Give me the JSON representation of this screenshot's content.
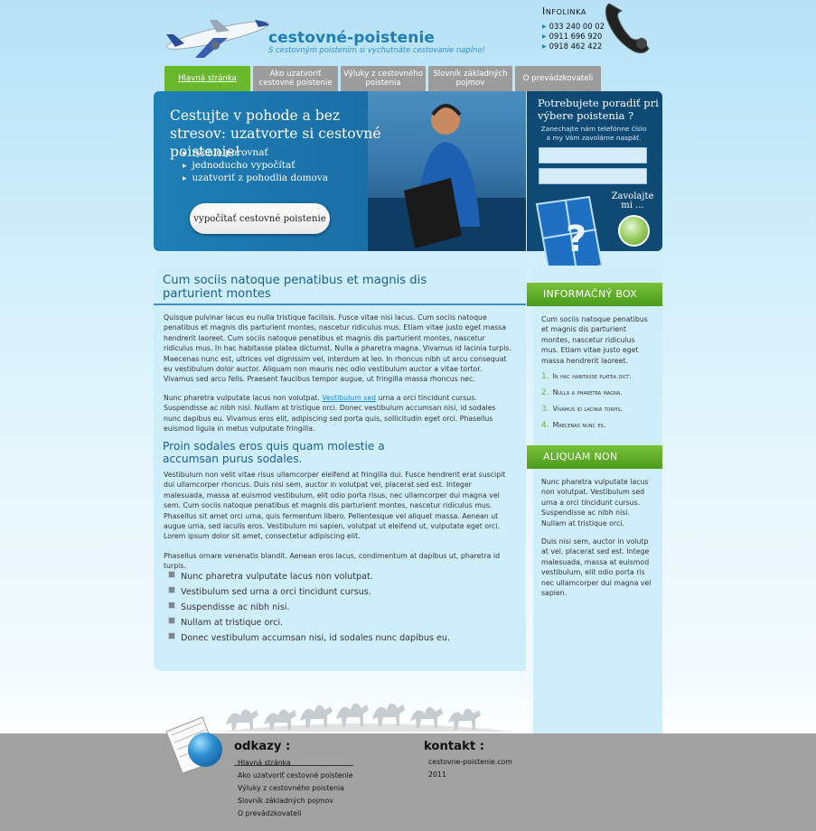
{
  "header": {
    "site_title": "cestovné-poistenie",
    "slogan": "S cestovným poistením si vychutnáte cestovanie naplno!",
    "infolinka_title": "Infolinka",
    "phones": [
      "033 240 00 02",
      "0911 696 920",
      "0918 462 422"
    ]
  },
  "nav": {
    "items": [
      {
        "label": "Hlavná stránka",
        "active": true
      },
      {
        "label": "Ako uzatvoriť cestovné poistenie"
      },
      {
        "label": "Výluky z cestovného poistenia"
      },
      {
        "label": "Slovník základných pojmov"
      },
      {
        "label": "O prevádzkovateli"
      }
    ]
  },
  "banner": {
    "headline": "Cestujte v pohode a bez stresov: uzatvorte si cestovné poistenie!",
    "bullets": [
      "rýchlo porovnať",
      "jednoducho vypočítať",
      "uzatvoriť z pohodlia domova"
    ],
    "cta_label": "vypočítať cestovné poistenie"
  },
  "callbox": {
    "title": "Potrebujete poradiť pri výbere poistenia ?",
    "subtitle": "Zanechajte nám telefónne číslo a my Vám zavoláme naspäť.",
    "call_label": "Zavolajte mi ..."
  },
  "main": {
    "heading1": "Cum sociis natoque penatibus et magnis dis parturient montes",
    "para1": "Quisque pulvinar lacus eu nulla tristique facilisis. Fusce vitae nisi lacus. Cum sociis natoque penatibus et magnis dis parturient montes, nascetur ridiculus mus. Etiam vitae justo eget massa hendrerit laoreet. Cum sociis natoque penatibus et magnis dis parturient montes, nascetur ridiculus mus. In hac habitasse platea dictumst. Nulla a pharetra magna. Vivamus id lacinia turpis. Maecenas nunc est, ultrices vel dignissim vel, interdum at leo. In rhoncus nibh ut arcu consequat eu vestibulum dolor auctor. Aliquam non mauris nec odio vestibulum auctor a vitae tortor. Vivamus sed arcu felis. Praesent faucibus tempor augue, ut fringilla massa rhoncus nec.",
    "para2_before": "Nunc pharetra vulputate lacus non volutpat. ",
    "para2_link": "Vestibulum sed",
    "para2_after": " urna a orci tincidunt cursus. Suspendisse ac nibh nisi. Nullam at tristique orci. Donec vestibulum accumsan nisi, id sodales nunc dapibus eu. Vivamus eros elit, adipiscing sed porta quis, sollicitudin eget orci. Phasellus euismod ligula in metus vulputate fringilla.",
    "heading2": "Proin sodales eros quis quam molestie a accumsan purus sodales.",
    "para3": "Vestibulum non velit vitae risus ullamcorper eleifend at fringilla dui. Fusce hendrerit erat suscipit dui ullamcorper rhoncus. Duis nisi sem, auctor in volutpat vel, placerat sed est. Integer malesuada, massa at euismod vestibulum, elit odio porta risus, nec ullamcorper dui magna vel sem. Cum sociis natoque penatibus et magnis dis parturient montes, nascetur ridiculus mus. Phasellus sit amet orci urna, quis fermentum libero. Pellentesque vel aliquet massa. Aenean ut augue urna, sed iaculis eros. Vestibulum mi sapien, volutpat ut eleifend ut, vulputate eget orci. Lorem ipsum dolor sit amet, consectetur adipiscing elit.",
    "para4": "Phasellus ornare venenatis blandit. Aenean eros lacus, condimentum at dapibus ut, pharetra id turpis.",
    "bullets": [
      "Nunc pharetra vulputate lacus non volutpat.",
      "Vestibulum sed urna a orci tincidunt cursus.",
      "Suspendisse ac nibh nisi.",
      "Nullam at tristique orci.",
      "Donec vestibulum accumsan nisi, id sodales nunc dapibus eu."
    ]
  },
  "sidebar": {
    "box1_title": "INFORMAČNÝ BOX",
    "box1_text": "Cum sociis natoque penatibus et magnis dis parturient montes, nascetur ridiculus mus. Etiam vitae justo eget massa hendrerit laoreet.",
    "box1_items": [
      "In hac habitasse platea dict.",
      "Nulla a pharetra magna.",
      "Vivamus id lacinia turpis.",
      "Maecenas nunc es."
    ],
    "box2_title": "ALIQUAM NON",
    "box2_text1": "Nunc pharetra vulputate lacus non volutpat. Vestibulum sed urna a orci tincidunt cursus. Suspendisse ac nibh nisi. Nullam at tristique orci.",
    "box2_text2": "Duis nisi sem, auctor in volutp at vel, placerat sed est. Intege malesuada, massa at euismod vestibulum, elit odio porta ris nec ullamcorper dui magna vel sapien."
  },
  "footer": {
    "links_title": "odkazy :",
    "links": [
      "Hlavná stránka",
      "Ako uzatvoriť cestovné poistenie",
      "Výluky z cestovného poistenia",
      "Slovník základných pojmov",
      "O prevádzkovateli"
    ],
    "contact_title": "kontakt :",
    "contact_lines": [
      "cestovne-poistenie.com",
      "2011"
    ]
  },
  "colors": {
    "accent_green": "#69b72b",
    "brand_blue": "#1f7fb4",
    "tab_gray": "#9c9c9c",
    "footer_gray": "#a2a2a2"
  }
}
